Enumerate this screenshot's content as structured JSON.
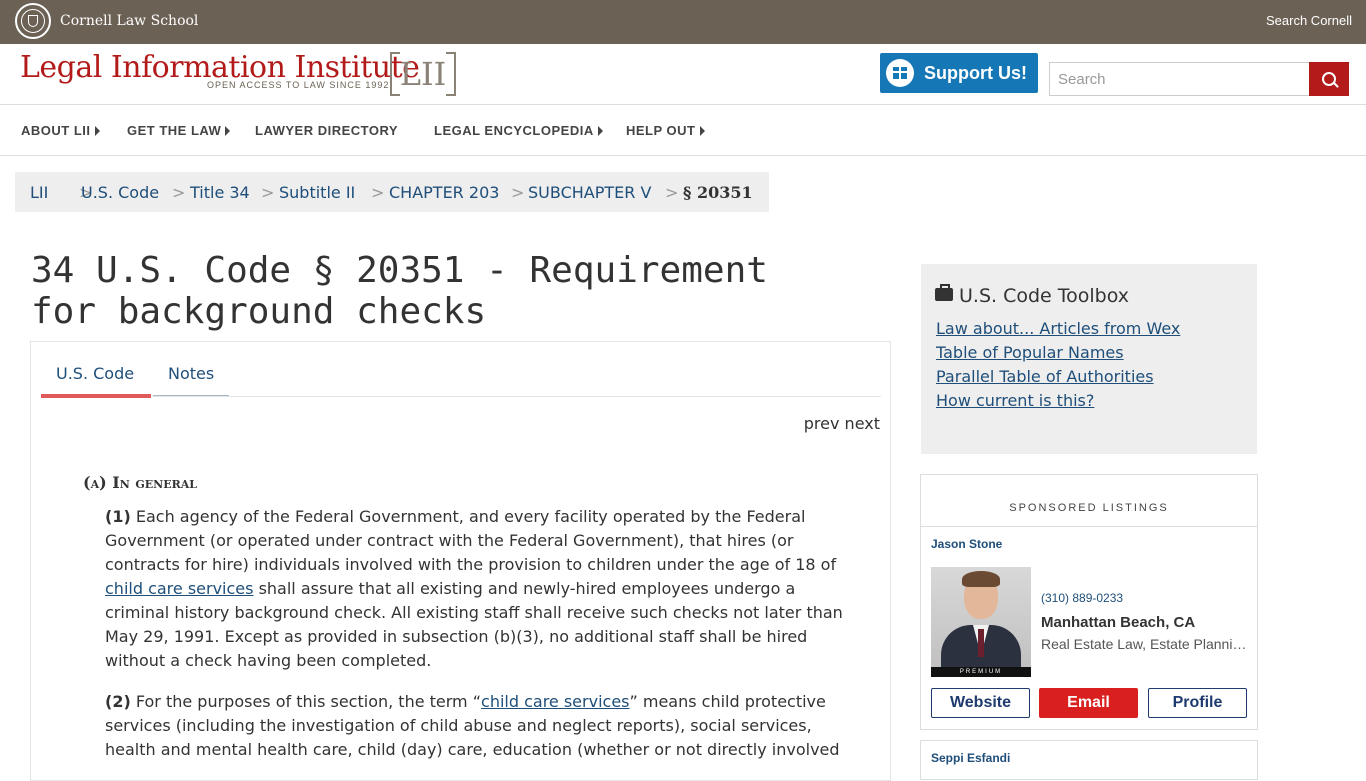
{
  "topbar": {
    "school": "Cornell Law School",
    "search_link": "Search Cornell"
  },
  "header": {
    "logo_title": "Legal Information Institute",
    "logo_tagline": "OPEN ACCESS TO LAW SINCE 1992",
    "logo_mark": "LII",
    "support_label": "Support Us!",
    "search_placeholder": "Search"
  },
  "nav": [
    {
      "label": "ABOUT LII",
      "has_caret": true
    },
    {
      "label": "GET THE LAW",
      "has_caret": true
    },
    {
      "label": "LAWYER DIRECTORY",
      "has_caret": false
    },
    {
      "label": "LEGAL ENCYCLOPEDIA",
      "has_caret": true
    },
    {
      "label": "HELP OUT",
      "has_caret": true
    }
  ],
  "breadcrumb": {
    "items": [
      "LII",
      "U.S. Code",
      "Title 34",
      "Subtitle II",
      "CHAPTER 203",
      "SUBCHAPTER V"
    ],
    "separator": ">",
    "current": "§ 20351"
  },
  "page": {
    "title": "34 U.S. Code § 20351 - Requirement for background checks",
    "tabs": [
      "U.S. Code",
      "Notes"
    ],
    "prev": "prev",
    "next": "next",
    "section_head": "(a) In general",
    "p1": {
      "num": "(1)",
      "before": " Each agency of the Federal Government, and every facility operated by the Federal Government (or operated under contract with the Federal Government), that hires (or contracts for hire) individuals involved with the provision to children under the age of 18 of ",
      "term": "child care services",
      "after": " shall assure that all existing and newly-hired employees undergo a criminal history background check. All existing staff shall receive such checks not later than May 29, 1991. Except as provided in subsection (b)(3), no additional staff shall be hired without a check having been completed."
    },
    "p2": {
      "num": "(2)",
      "before": " For the purposes of this section, the term “",
      "term": "child care services",
      "after": "” means child protective services (including the investigation of child abuse and neglect reports), social services, health and mental health care, child (day) care, education (whether or not directly involved"
    }
  },
  "toolbox": {
    "title": "U.S. Code Toolbox",
    "links": [
      "Law about... Articles from Wex",
      "Table of Popular Names",
      "Parallel Table of Authorities",
      "How current is this?"
    ]
  },
  "sponsored": {
    "heading": "SPONSORED LISTINGS",
    "listing": {
      "name": "Jason Stone",
      "badge": "PREMIUM",
      "phone": "(310) 889-0233",
      "city": "Manhattan Beach, CA",
      "practice": "Real Estate Law, Estate Planning",
      "buttons": [
        "Website",
        "Email",
        "Profile"
      ]
    },
    "next_name": "Seppi Esfandi"
  },
  "colors": {
    "topbar": "#6b6255",
    "brand_red": "#b31b1b",
    "support_blue": "#1577b5",
    "link": "#1e4e79",
    "tab_active": "#e05a5a",
    "email_btn": "#d9201e"
  }
}
